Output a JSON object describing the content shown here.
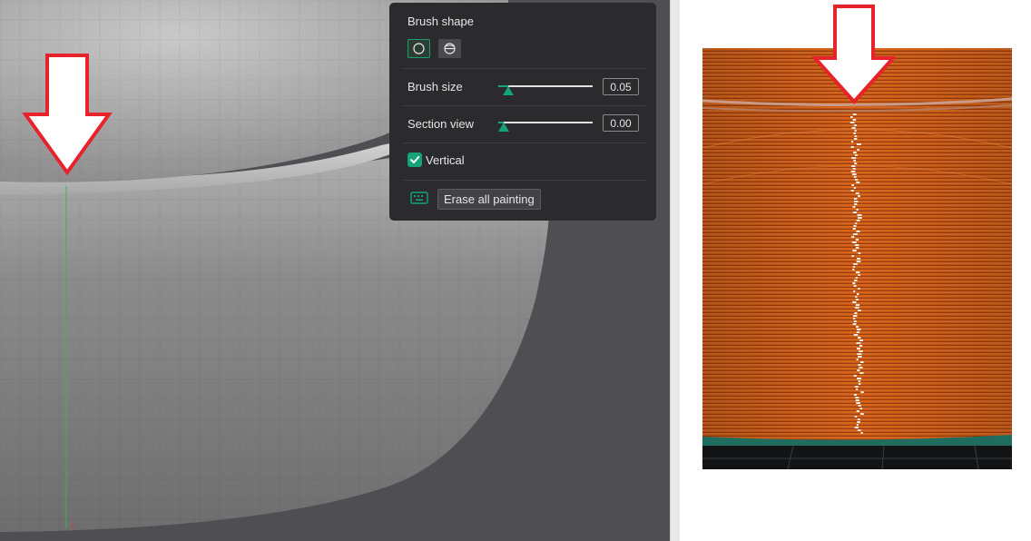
{
  "panel": {
    "brush_shape_title": "Brush shape",
    "shape_icons": [
      "circle-icon",
      "sphere-icon"
    ],
    "brush_size_label": "Brush size",
    "brush_size_value": "0.05",
    "brush_size_fraction": 0.05,
    "section_view_label": "Section view",
    "section_view_value": "0.00",
    "section_view_fraction": 0.0,
    "vertical_label": "Vertical",
    "vertical_checked": true,
    "erase_label": "Erase all painting",
    "keyboard_icon": "keyboard-icon"
  },
  "colors": {
    "accent": "#16a37a",
    "panel_bg": "#2b2b2e",
    "viewport_bg": "#4f4f53",
    "arrow_outline": "#e8222a",
    "print_orange": "#d8671e"
  }
}
